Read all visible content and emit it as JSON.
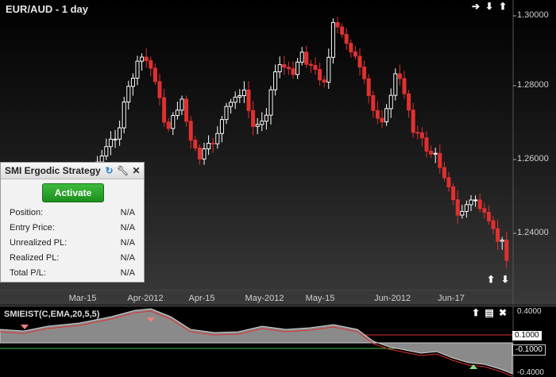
{
  "chart": {
    "title": "EUR/AUD - 1 day",
    "price_labels": [
      "1.30000",
      "1.28000",
      "1.26000",
      "1.24000"
    ],
    "date_labels": [
      "Mar-15",
      "Apr-2012",
      "Apr-15",
      "May-2012",
      "May-15",
      "Jun-2012",
      "Jun-17"
    ],
    "toolbar_icons": [
      "arrow-right-icon",
      "arrow-down-icon",
      "arrow-up-icon"
    ],
    "colors": {
      "up": "#ffffff",
      "down": "#e03030",
      "background": "#000000"
    }
  },
  "panel": {
    "title": "SMI Ergodic Strategy",
    "activate_label": "Activate",
    "rows": [
      {
        "label": "Position:",
        "value": "N/A"
      },
      {
        "label": "Entry Price:",
        "value": "N/A"
      },
      {
        "label": "Unrealized PL:",
        "value": "N/A"
      },
      {
        "label": "Realized PL:",
        "value": "N/A"
      },
      {
        "label": "Total P/L:",
        "value": "N/A"
      }
    ]
  },
  "indicator": {
    "title": "SMIEIST(C,EMA,20,5,5)",
    "labels": {
      "top": "0.4000",
      "upper": "0.1000",
      "lower": "-0.1000",
      "bottom": "-0.4000"
    }
  }
}
